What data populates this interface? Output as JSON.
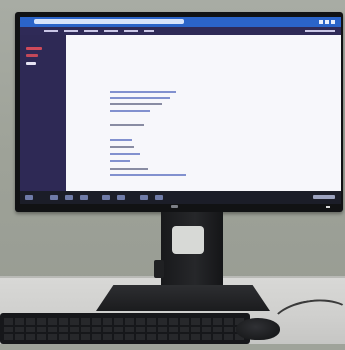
{
  "scene": {
    "description_tags": [
      "desk",
      "monitor",
      "keyboard",
      "mouse"
    ],
    "colors": {
      "browser_bar": "#2b64c9",
      "app_bar": "#2f2a57",
      "sidebar": "#2e2955",
      "page_background": "#f7f7fb",
      "taskbar": "#1b1d28"
    }
  },
  "screen": {
    "sidebar_icons": [
      {
        "icon": "app-icon",
        "color": "#d04a5a"
      },
      {
        "icon": "app-icon",
        "color": "#d04a5a"
      },
      {
        "icon": "app-icon",
        "color": "#e6e3f3"
      }
    ],
    "content_lines": [
      {
        "style": "link"
      },
      {
        "style": "link"
      },
      {
        "style": "dark"
      },
      {
        "style": "link"
      },
      {
        "style": "dark"
      },
      {
        "style": "link"
      },
      {
        "style": "dark"
      },
      {
        "style": "link"
      },
      {
        "style": "link"
      },
      {
        "style": "dark"
      },
      {
        "style": "link"
      }
    ]
  }
}
